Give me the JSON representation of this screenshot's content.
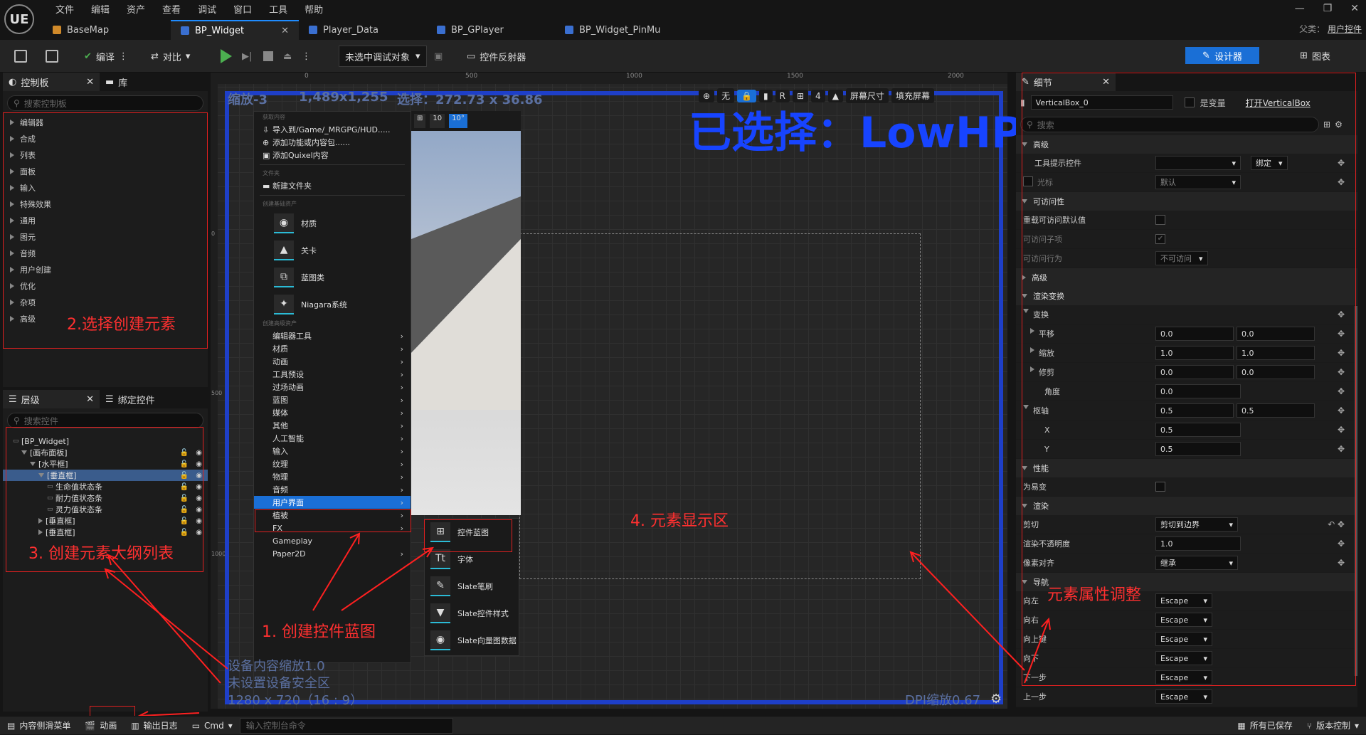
{
  "app": {
    "logo": "UE"
  },
  "menu": [
    "文件",
    "编辑",
    "资产",
    "查看",
    "调试",
    "窗口",
    "工具",
    "帮助"
  ],
  "parent_class": {
    "label": "父类：",
    "value": "用户控件"
  },
  "tabs": [
    {
      "label": "BaseMap",
      "icon": "level-icon"
    },
    {
      "label": "BP_Widget",
      "icon": "widget-icon",
      "active": true
    },
    {
      "label": "Player_Data",
      "icon": "blueprint-icon"
    },
    {
      "label": "BP_GPlayer",
      "icon": "player-icon"
    },
    {
      "label": "BP_Widget_PinMu",
      "icon": "widget-icon"
    }
  ],
  "toolbar": {
    "compile": "编译",
    "diff": "对比",
    "debug_target": "未选中调试对象",
    "reflector": "控件反射器",
    "designer": "设计器",
    "graph": "图表"
  },
  "palette": {
    "tab_palette": "控制板",
    "tab_library": "库",
    "search_placeholder": "搜索控制板",
    "categories": [
      "编辑器",
      "合成",
      "列表",
      "面板",
      "输入",
      "特殊效果",
      "通用",
      "图元",
      "音频",
      "用户创建",
      "优化",
      "杂项",
      "高级"
    ]
  },
  "hierarchy": {
    "tab_hierarchy": "层级",
    "tab_bind": "绑定控件",
    "search_placeholder": "搜索控件",
    "rows": [
      {
        "label": "[BP_Widget]",
        "indent": 0,
        "expander": "",
        "locks": false
      },
      {
        "label": "[画布面板]",
        "indent": 1,
        "expander": "down",
        "locks": true
      },
      {
        "label": "[水平框]",
        "indent": 2,
        "expander": "down",
        "locks": true
      },
      {
        "label": "[垂直框]",
        "indent": 3,
        "expander": "down",
        "locks": true,
        "selected": true
      },
      {
        "label": "生命值状态条",
        "indent": 4,
        "expander": "",
        "locks": true
      },
      {
        "label": "耐力值状态条",
        "indent": 4,
        "expander": "",
        "locks": true
      },
      {
        "label": "灵力值状态条",
        "indent": 4,
        "expander": "",
        "locks": true
      },
      {
        "label": "[垂直框]",
        "indent": 3,
        "expander": "right",
        "locks": true
      },
      {
        "label": "[垂直框]",
        "indent": 3,
        "expander": "right",
        "locks": true
      }
    ]
  },
  "viewport": {
    "zoom": "缩放-3",
    "resolution": "1,489x1,255",
    "selection": "选择：272.73 x 36.86",
    "ruler_ticks": [
      "0",
      "500",
      "1000",
      "1500",
      "2000"
    ],
    "ruler_left_ticks": [
      "0",
      "500",
      "1000"
    ],
    "overlay": {
      "none": "无",
      "r": "R",
      "grid": "4",
      "screen_size": "屏幕尺寸",
      "fill_screen": "填充屏幕"
    },
    "scene_overlay": {
      "grid": "10",
      "angle": "10°"
    },
    "device_scale": "设备内容缩放1.0",
    "safe_zone": "未设置设备安全区",
    "screen_res": "1280 x 720（16 : 9）",
    "dpi_scale": "DPI缩放0.67",
    "selected_banner": "已选择：LowHP"
  },
  "context_menu": {
    "hdr_get": "获取内容",
    "get_items": [
      "导入到/Game/_MRGPG/HUD.....",
      "添加功能或内容包......",
      "添加Quixel内容"
    ],
    "hdr_folder": "文件夹",
    "new_folder": "新建文件夹",
    "hdr_basic": "创建基础资产",
    "basic_items": [
      "材质",
      "关卡",
      "蓝图类",
      "Niagara系统"
    ],
    "hdr_advanced": "创建高级资产",
    "advanced_items": [
      "编辑器工具",
      "材质",
      "动画",
      "工具预设",
      "过场动画",
      "蓝图",
      "媒体",
      "其他",
      "人工智能",
      "输入",
      "纹理",
      "物理",
      "音频",
      "用户界面",
      "植被",
      "FX",
      "Gameplay",
      "Paper2D"
    ],
    "highlighted": "用户界面"
  },
  "submenu": {
    "items": [
      {
        "label": "控件蓝图",
        "icon": "widget-blueprint-icon"
      },
      {
        "label": "字体",
        "icon": "font-icon"
      },
      {
        "label": "Slate笔刷",
        "icon": "brush-icon"
      },
      {
        "label": "Slate控件样式",
        "icon": "style-icon"
      },
      {
        "label": "Slate向量图数据",
        "icon": "vector-icon"
      }
    ]
  },
  "details": {
    "tab": "细节",
    "name": "VerticalBox_0",
    "is_variable": "是变量",
    "open_link": "打开VerticalBox",
    "search_placeholder": "搜索",
    "sec_advanced": "高级",
    "tooltip_widget": "工具提示控件",
    "bind": "绑定",
    "cursor": "光标",
    "cursor_value": "默认",
    "sec_accessibility": "可访问性",
    "override_access": "重载可访问默认值",
    "access_children": "可访问子项",
    "access_behavior": "可访问行为",
    "access_behavior_value": "不可访问",
    "sec_advanced2": "高级",
    "sec_render_transform": "渲染变换",
    "transform": "变换",
    "translation": "平移",
    "translation_x": "0.0",
    "translation_y": "0.0",
    "scale": "缩放",
    "scale_x": "1.0",
    "scale_y": "1.0",
    "shear": "修剪",
    "shear_x": "0.0",
    "shear_y": "0.0",
    "angle": "角度",
    "angle_value": "0.0",
    "pivot": "枢轴",
    "pivot_x": "0.5",
    "pivot_y": "0.5",
    "x_label": "X",
    "x_value": "0.5",
    "y_label": "Y",
    "y_value": "0.5",
    "sec_performance": "性能",
    "volatile": "为易变",
    "sec_rendering": "渲染",
    "clipping": "剪切",
    "clipping_value": "剪切到边界",
    "opacity": "渲染不透明度",
    "opacity_value": "1.0",
    "pixel_snap": "像素对齐",
    "pixel_snap_value": "继承",
    "sec_navigation": "导航",
    "nav_rows": [
      {
        "label": "向左",
        "value": "Escape"
      },
      {
        "label": "向右",
        "value": "Escape"
      },
      {
        "label": "向上键",
        "value": "Escape"
      },
      {
        "label": "向下",
        "value": "Escape"
      },
      {
        "label": "下一步",
        "value": "Escape"
      },
      {
        "label": "上一步",
        "value": "Escape"
      }
    ]
  },
  "annotations": {
    "a1": "1. 创建控件蓝图",
    "a2": "2.选择创建元素",
    "a3": "3. 创建元素大纲列表",
    "a4": "4. 元素显示区",
    "a5": "元素属性调整"
  },
  "statusbar": {
    "content_drawer": "内容侧滑菜单",
    "animation": "动画",
    "output_log": "输出日志",
    "cmd": "Cmd",
    "console_placeholder": "输入控制台命令",
    "saved": "所有已保存",
    "source_control": "版本控制"
  }
}
